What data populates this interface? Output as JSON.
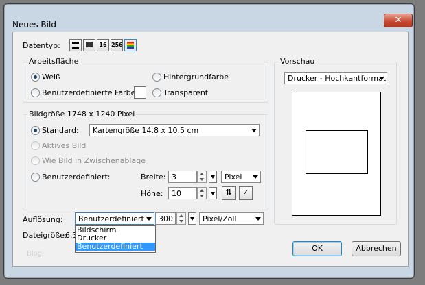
{
  "window": {
    "title": "Neues Bild",
    "close_symbol": "✕"
  },
  "datentyp": {
    "label": "Datentyp:",
    "buttons": [
      "",
      "",
      "16",
      "256",
      ""
    ]
  },
  "arbeitsflaeche": {
    "title": "Arbeitsfläche",
    "weiss": "Weiß",
    "hintergrundfarbe": "Hintergrundfarbe",
    "benutzerdefinierte_farbe": "Benutzerdefinierte Farbe:",
    "transparent": "Transparent"
  },
  "bildgroesse": {
    "title": "Bildgröße 1748 x 1240 Pixel",
    "standard_label": "Standard:",
    "standard_value": "Kartengröße 14.8 x 10.5  cm",
    "aktives_bild": "Aktives Bild",
    "wie_bild": "Wie Bild in Zwischenablage",
    "benutzerdefiniert": "Benutzerdefiniert:",
    "breite_label": "Breite:",
    "breite_value": "3",
    "hoehe_label": "Höhe:",
    "hoehe_value": "10",
    "unit_value": "Pixel"
  },
  "aufloesung": {
    "label": "Auflösung:",
    "mode_value": "Benutzerdefiniert",
    "value": "300",
    "unit_value": "Pixel/Zoll",
    "options": [
      "Bildschirm",
      "Drucker",
      "Benutzerdefiniert"
    ],
    "selected_index": 2
  },
  "dateigroesse": {
    "label": "Dateigröße:",
    "value": "6.3"
  },
  "vorschau": {
    "title": "Vorschau",
    "combo_value": "Drucker - Hochkantformat"
  },
  "buttons": {
    "ok": "OK",
    "cancel": "Abbrechen"
  },
  "watermark": "Blog",
  "colors": {
    "selection": "#3399ff",
    "dialog_bg": "#f0f0f0",
    "frame": "#c9d6e4",
    "close": "#c74a32"
  }
}
